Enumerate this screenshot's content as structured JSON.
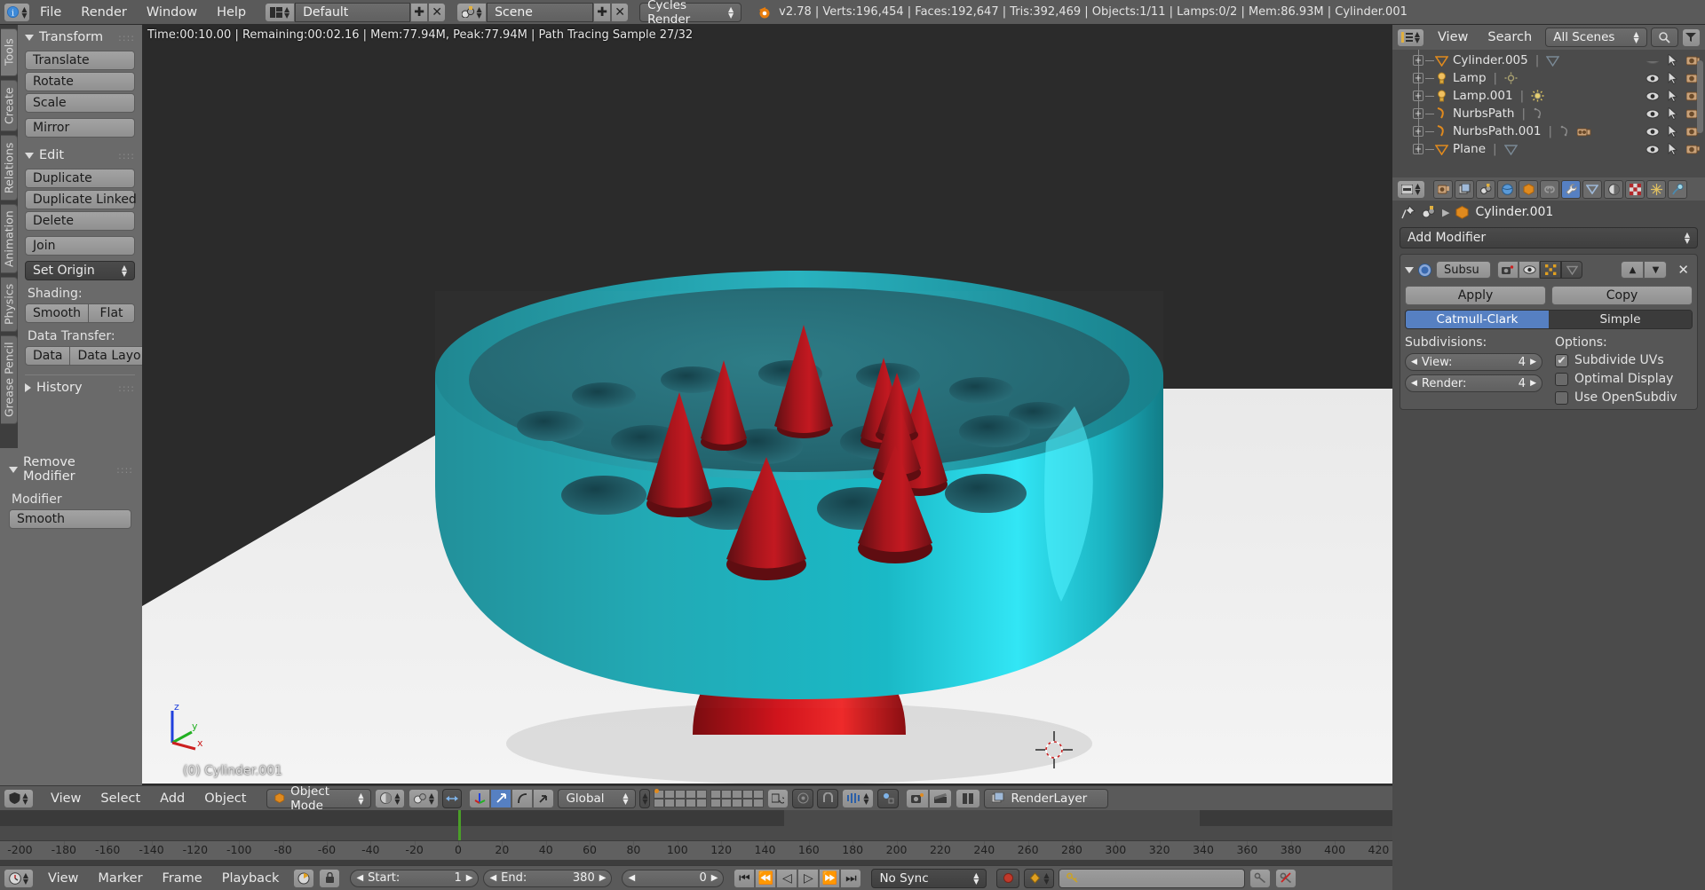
{
  "topbar": {
    "menus": [
      "File",
      "Render",
      "Window",
      "Help"
    ],
    "screen_layout": "Default",
    "scene_name": "Scene",
    "render_engine": "Cycles Render",
    "stats": "v2.78 | Verts:196,454 | Faces:192,647 | Tris:392,469 | Objects:1/11 | Lamps:0/2 | Mem:86.93M | Cylinder.001"
  },
  "toolshelf": {
    "tabs": [
      "Tools",
      "Create",
      "Relations",
      "Animation",
      "Physics",
      "Grease Pencil"
    ],
    "active_tab": "Tools",
    "panels": [
      {
        "title": "Transform",
        "open": true,
        "buttons": [
          "Translate",
          "Rotate",
          "Scale",
          "Mirror"
        ]
      },
      {
        "title": "Edit",
        "open": true,
        "buttons": [
          "Duplicate",
          "Duplicate Linked",
          "Delete",
          "Join"
        ],
        "set_origin": "Set Origin",
        "shading_label": "Shading:",
        "shading": [
          "Smooth",
          "Flat"
        ],
        "data_transfer_label": "Data Transfer:",
        "data_transfer": [
          "Data",
          "Data Layo"
        ]
      },
      {
        "title": "History",
        "open": false
      }
    ],
    "remove_modifier": {
      "title": "Remove Modifier",
      "field_label": "Modifier",
      "field_value": "Smooth"
    }
  },
  "viewport": {
    "render_info": "Time:00:10.00 | Remaining:00:02.16 | Mem:77.94M, Peak:77.94M | Path Tracing Sample 27/32",
    "object_label": "(0) Cylinder.001",
    "axes": {
      "x": "x",
      "y": "y",
      "z": "z"
    },
    "header": {
      "menus": [
        "View",
        "Select",
        "Add",
        "Object"
      ],
      "mode": "Object Mode",
      "transform_orientation": "Global",
      "render_layer": "RenderLayer"
    }
  },
  "outliner": {
    "menus": [
      "View",
      "Search"
    ],
    "scope": "All Scenes",
    "rows": [
      {
        "name": "Cylinder.005",
        "type": "mesh",
        "hidden": true
      },
      {
        "name": "Lamp",
        "type": "lamp",
        "hidden": false
      },
      {
        "name": "Lamp.001",
        "type": "lamp",
        "hidden": false
      },
      {
        "name": "NurbsPath",
        "type": "curve",
        "hidden": false
      },
      {
        "name": "NurbsPath.001",
        "type": "curve",
        "hidden": false,
        "camera": true
      },
      {
        "name": "Plane",
        "type": "mesh",
        "hidden": false
      }
    ]
  },
  "properties": {
    "active_tab": "modifier",
    "breadcrumb_object": "Cylinder.001",
    "add_modifier": "Add Modifier",
    "modifier": {
      "name": "Subsu",
      "apply": "Apply",
      "copy": "Copy",
      "algorithm": [
        "Catmull-Clark",
        "Simple"
      ],
      "algorithm_active": "Catmull-Clark",
      "subdivisions_label": "Subdivisions:",
      "view_label": "View:",
      "view_value": "4",
      "render_label": "Render:",
      "render_value": "4",
      "options_label": "Options:",
      "options": [
        {
          "label": "Subdivide UVs",
          "checked": true
        },
        {
          "label": "Optimal Display",
          "checked": false
        },
        {
          "label": "Use OpenSubdiv",
          "checked": false
        }
      ]
    }
  },
  "timeline": {
    "menus": [
      "View",
      "Marker",
      "Frame",
      "Playback"
    ],
    "start_label": "Start:",
    "start_value": "1",
    "end_label": "End:",
    "end_value": "380",
    "current_frame": "0",
    "sync_mode": "No Sync",
    "ruler_ticks": [
      "-200",
      "-180",
      "-160",
      "-140",
      "-120",
      "-100",
      "-80",
      "-60",
      "-40",
      "-20",
      "0",
      "20",
      "40",
      "60",
      "80",
      "100",
      "120",
      "140",
      "160",
      "180",
      "200",
      "220",
      "240",
      "260",
      "280",
      "300",
      "320",
      "340",
      "360",
      "380",
      "400",
      "420"
    ]
  },
  "colors": {
    "accent_blue": "#5680c2",
    "header_gray": "#5a5a5a",
    "panel_gray": "#6a6a6a",
    "viewport_bg": "#2b2b2b",
    "playhead_green": "#4a9e28"
  }
}
